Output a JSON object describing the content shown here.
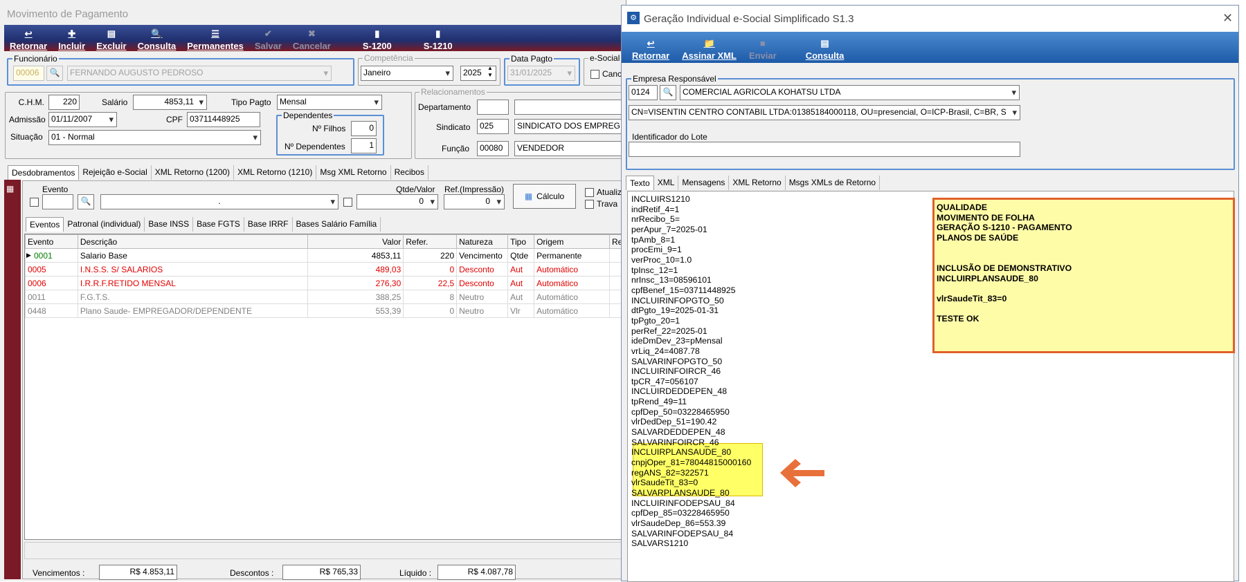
{
  "main": {
    "title": "Movimento de Pagamento",
    "toolbar": [
      {
        "label": "Retornar",
        "icon": "↩",
        "enabled": true
      },
      {
        "label": "Incluir",
        "icon": "✚",
        "enabled": true
      },
      {
        "label": "Excluir",
        "icon": "▤",
        "enabled": true
      },
      {
        "label": "Consulta",
        "icon": "🔍",
        "enabled": true
      },
      {
        "label": "Permanentes",
        "icon": "☰",
        "enabled": true
      },
      {
        "label": "Salvar",
        "icon": "✔",
        "enabled": false
      },
      {
        "label": "Cancelar",
        "icon": "✖",
        "enabled": false
      },
      {
        "label": "S-1200",
        "icon": "▮",
        "enabled": true
      },
      {
        "label": "S-1210",
        "icon": "▮",
        "enabled": true
      }
    ],
    "funcionario": {
      "legend": "Funcionário",
      "code": "00006",
      "name": "FERNANDO AUGUSTO PEDROSO"
    },
    "competencia": {
      "legend": "Competência",
      "month": "Janeiro",
      "year": "2025"
    },
    "data_pagto": {
      "legend": "Data Pagto",
      "value": "31/01/2025"
    },
    "esocial": {
      "legend": "e-Social",
      "check_label": "Canc"
    },
    "chm": {
      "label": "C.H.M.",
      "value": "220"
    },
    "salario": {
      "label": "Salário",
      "value": "4853,11"
    },
    "tipo_pagto": {
      "label": "Tipo Pagto",
      "value": "Mensal"
    },
    "admissao": {
      "label": "Admissão",
      "value": "01/11/2007"
    },
    "cpf": {
      "label": "CPF",
      "value": "03711448925"
    },
    "situacao": {
      "label": "Situação",
      "value": "01 - Normal"
    },
    "dependentes": {
      "legend": "Dependentes",
      "filhos_label": "Nº Filhos",
      "filhos": "0",
      "dep_label": "Nº Dependentes",
      "dep": "1"
    },
    "relacionamentos": {
      "legend": "Relacionamentos",
      "departamento_label": "Departamento",
      "sindicato_label": "Sindicato",
      "sindicato_code": "025",
      "sindicato_name": "SINDICATO DOS EMPREG",
      "funcao_label": "Função",
      "funcao_code": "00080",
      "funcao_name": "VENDEDOR"
    },
    "tabs": [
      "Desdobramentos",
      "Rejeição e-Social",
      "XML Retorno (1200)",
      "XML Retorno (1210)",
      "Msg XML Retorno",
      "Recibos"
    ],
    "evento_label": "Evento",
    "qtde_label": "Qtde/Valor",
    "qtde_value": "0",
    "ref_label": "Ref.(Impressão)",
    "ref_value": "0",
    "calculo_label": "Cálculo",
    "evento_desc_value": ".",
    "atualiz_label": "Atualiz",
    "trava_label": "Trava",
    "subtabs": [
      "Eventos",
      "Patronal (individual)",
      "Base INSS",
      "Base FGTS",
      "Base IRRF",
      "Bases Salário Família"
    ],
    "columns": [
      "Evento",
      "Descrição",
      "Valor",
      "Refer.",
      "Natureza",
      "Tipo",
      "Origem",
      "Re"
    ],
    "rows": [
      {
        "evento": "0001",
        "descricao": "Salario Base",
        "valor": "4853,11",
        "refer": "220",
        "natureza": "Vencimento",
        "tipo": "Qtde",
        "origem": "Permanente",
        "color": "green"
      },
      {
        "evento": "0005",
        "descricao": "I.N.S.S. S/ SALARIOS",
        "valor": "489,03",
        "refer": "0",
        "natureza": "Desconto",
        "tipo": "Aut",
        "origem": "Automático",
        "color": "red"
      },
      {
        "evento": "0006",
        "descricao": "I.R.R.F.RETIDO MENSAL",
        "valor": "276,30",
        "refer": "22,5",
        "natureza": "Desconto",
        "tipo": "Aut",
        "origem": "Automático",
        "color": "red"
      },
      {
        "evento": "0011",
        "descricao": "F.G.T.S.",
        "valor": "388,25",
        "refer": "8",
        "natureza": "Neutro",
        "tipo": "Aut",
        "origem": "Automático",
        "color": "gray"
      },
      {
        "evento": "0448",
        "descricao": "Plano Saude- EMPREGADOR/DEPENDENTE",
        "valor": "553,39",
        "refer": "0",
        "natureza": "Neutro",
        "tipo": "Vlr",
        "origem": "Automático",
        "color": "gray"
      }
    ],
    "totals": {
      "venc_label": "Vencimentos :",
      "venc": "R$ 4.853,11",
      "desc_label": "Descontos :",
      "desc": "R$ 765,33",
      "liq_label": "Líquido :",
      "liq": "R$ 4.087,78"
    }
  },
  "dialog": {
    "title": "Geração Individual e-Social Simplificado S1.3",
    "toolbar": [
      {
        "label": "Retornar",
        "icon": "↩",
        "enabled": true
      },
      {
        "label": "Assinar XML",
        "icon": "📁",
        "enabled": true
      },
      {
        "label": "Enviar",
        "icon": "■",
        "enabled": false
      },
      {
        "label": "Consulta",
        "icon": "▤",
        "enabled": true
      }
    ],
    "empresa_legend": "Empresa Responsável",
    "empresa_code": "0124",
    "empresa_name": "COMERCIAL AGRICOLA KOHATSU LTDA",
    "certificado": "CN=VISENTIN CENTRO CONTABIL LTDA:01385184000118, OU=presencial, O=ICP-Brasil, C=BR, S",
    "lote_label": "Identificador do Lote",
    "lote_value": "",
    "tabs": [
      "Texto",
      "XML",
      "Mensagens",
      "XML Retorno",
      "Msgs XMLs de Retorno"
    ],
    "text_lines": [
      "INCLUIRS1210",
      "indRetif_4=1",
      "nrRecibo_5=",
      "perApur_7=2025-01",
      "tpAmb_8=1",
      "procEmi_9=1",
      "verProc_10=1.0",
      "tpInsc_12=1",
      "nrInsc_13=08596101",
      "cpfBenef_15=03711448925",
      "INCLUIRINFOPGTO_50",
      "dtPgto_19=2025-01-31",
      "tpPgto_20=1",
      "perRef_22=2025-01",
      "ideDmDev_23=pMensal",
      "vrLiq_24=4087.78",
      "SALVARINFOPGTO_50",
      "INCLUIRINFOIRCR_46",
      "tpCR_47=056107",
      "INCLUIRDEDDEPEN_48",
      "tpRend_49=11",
      "cpfDep_50=03228465950",
      "vlrDedDep_51=190.42",
      "SALVARDEDDEPEN_48",
      "SALVARINFOIRCR_46",
      "INCLUIRPLANSAUDE_80",
      "cnpjOper_81=78044815000160",
      "regANS_82=322571",
      "vlrSaudeTit_83=0",
      "SALVARPLANSAUDE_80",
      "INCLUIRINFODEPSAU_84",
      "cpfDep_85=03228465950",
      "vlrSaudeDep_86=553.39",
      "SALVARINFODEPSAU_84",
      "SALVARS1210"
    ],
    "note_lines": [
      "QUALIDADE",
      "MOVIMENTO DE FOLHA",
      "GERAÇÃO S-1210 - PAGAMENTO",
      "PLANOS DE SAÚDE",
      "",
      "",
      "INCLUSÃO DE DEMONSTRATIVO",
      "INCLUIRPLANSAUDE_80",
      "",
      "vlrSaudeTit_83=0",
      "",
      "TESTE OK"
    ],
    "arrow_icon": "arrow-left-icon"
  },
  "colors": {
    "green": "#008000",
    "red": "#e00000",
    "gray": "#808080",
    "highlight": "#ffff66",
    "note_border": "#e0602a",
    "arrow": "#e8703a"
  }
}
